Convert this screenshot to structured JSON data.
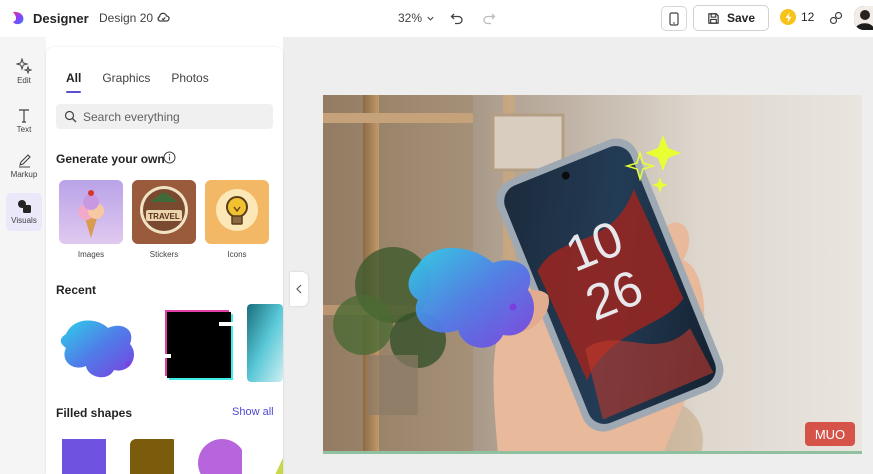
{
  "header": {
    "app_name": "Designer",
    "document_name": "Design 20",
    "zoom_level": "32%",
    "save_label": "Save",
    "credits": "12"
  },
  "rail": {
    "items": [
      {
        "label": "Edit",
        "icon": "sparkle-edit-icon"
      },
      {
        "label": "Text",
        "icon": "text-icon"
      },
      {
        "label": "Markup",
        "icon": "pen-icon"
      },
      {
        "label": "Visuals",
        "icon": "shapes-icon",
        "active": true
      }
    ]
  },
  "panel": {
    "tabs": [
      {
        "label": "All",
        "active": true
      },
      {
        "label": "Graphics"
      },
      {
        "label": "Photos"
      }
    ],
    "search_placeholder": "Search everything",
    "generate_title": "Generate your own",
    "generate_items": [
      {
        "label": "Images"
      },
      {
        "label": "Stickers",
        "sticker_text": "TRAVEL"
      },
      {
        "label": "Icons"
      }
    ],
    "recent_title": "Recent",
    "filled_shapes_title": "Filled shapes",
    "show_all_label": "Show all"
  },
  "canvas": {
    "phone_time_hours": "10",
    "phone_time_minutes": "26",
    "watermark": "MUO"
  },
  "colors": {
    "accent": "#5b4fd6",
    "coin": "#f7c31b",
    "shape_purple": "#7052e0",
    "shape_olive": "#7a5c0c",
    "shape_orchid": "#b765dc",
    "sparkle": "#e7ff33"
  }
}
